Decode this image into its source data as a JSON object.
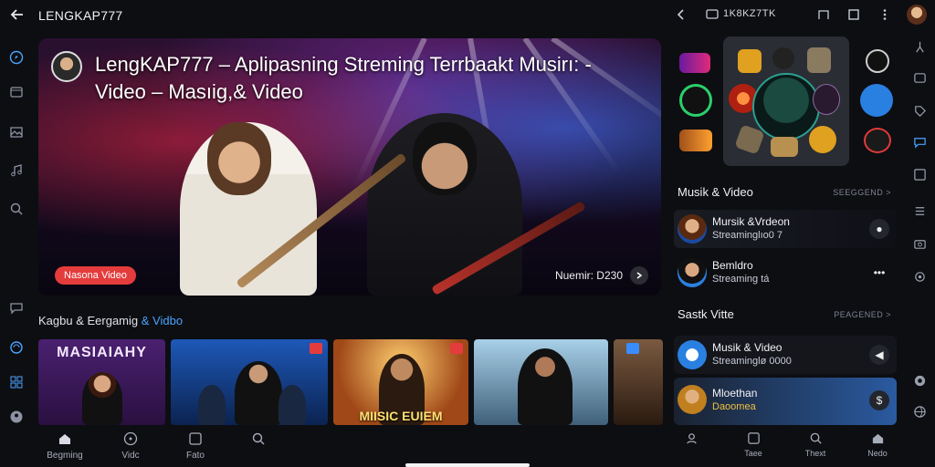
{
  "app": {
    "title": "LENGKAP777"
  },
  "hero": {
    "title": "LengKAP777 – Aplipasning Streming Terrbaakt Musirı: - Video – Masıig,& Video",
    "badge": "Nasona Video",
    "meta": "Nuemir: D230"
  },
  "section": {
    "title_prefix": "Kagbu & Eergamig",
    "title_accent": "& Vidbo"
  },
  "thumbnails": [
    {
      "label": "MASIAIAHY",
      "colors": [
        "#3a1a5a",
        "#b04ad0"
      ]
    },
    {
      "label": "",
      "colors": [
        "#0c2a55",
        "#3a8dff"
      ]
    },
    {
      "label": "MIISIC EUIEM",
      "colors": [
        "#6a2a10",
        "#ffb040"
      ]
    },
    {
      "label": "",
      "colors": [
        "#2a3a40",
        "#7fb6d6"
      ]
    },
    {
      "label": "",
      "colors": [
        "#3a2a20",
        "#8a6a50"
      ]
    }
  ],
  "bottom_nav": [
    {
      "label": "Begming",
      "icon": "home-icon"
    },
    {
      "label": "Vidc",
      "icon": "play-icon"
    },
    {
      "label": "Fato",
      "icon": "square-icon"
    },
    {
      "label": "",
      "icon": "search-icon"
    }
  ],
  "right_panel": {
    "top_title": "1K8KZ7TK",
    "section1": {
      "title": "Musik & Video",
      "more": "SEEGGEND >"
    },
    "items1": [
      {
        "name": "Mursik &Vrdeon",
        "sub": "Streaminglıo0 7"
      },
      {
        "name": "Bemldro",
        "sub": "Streaming tá"
      }
    ],
    "section2": {
      "title": "Sastk Vitte",
      "more": "PEAGENED >"
    },
    "items2": [
      {
        "name": "Musik & Video",
        "sub": "Streaminglø 0000"
      },
      {
        "name": "Mloethan",
        "sub": "Daoomea"
      }
    ],
    "nav": [
      {
        "label": "",
        "icon": "user-icon"
      },
      {
        "label": "Taee",
        "icon": "square-icon"
      },
      {
        "label": "Thext",
        "icon": "search-icon"
      },
      {
        "label": "Nedo",
        "icon": "home-icon"
      }
    ]
  },
  "colors": {
    "accent": "#4aa3ff",
    "badge": "#e43c3c",
    "bg": "#0d0e12"
  }
}
